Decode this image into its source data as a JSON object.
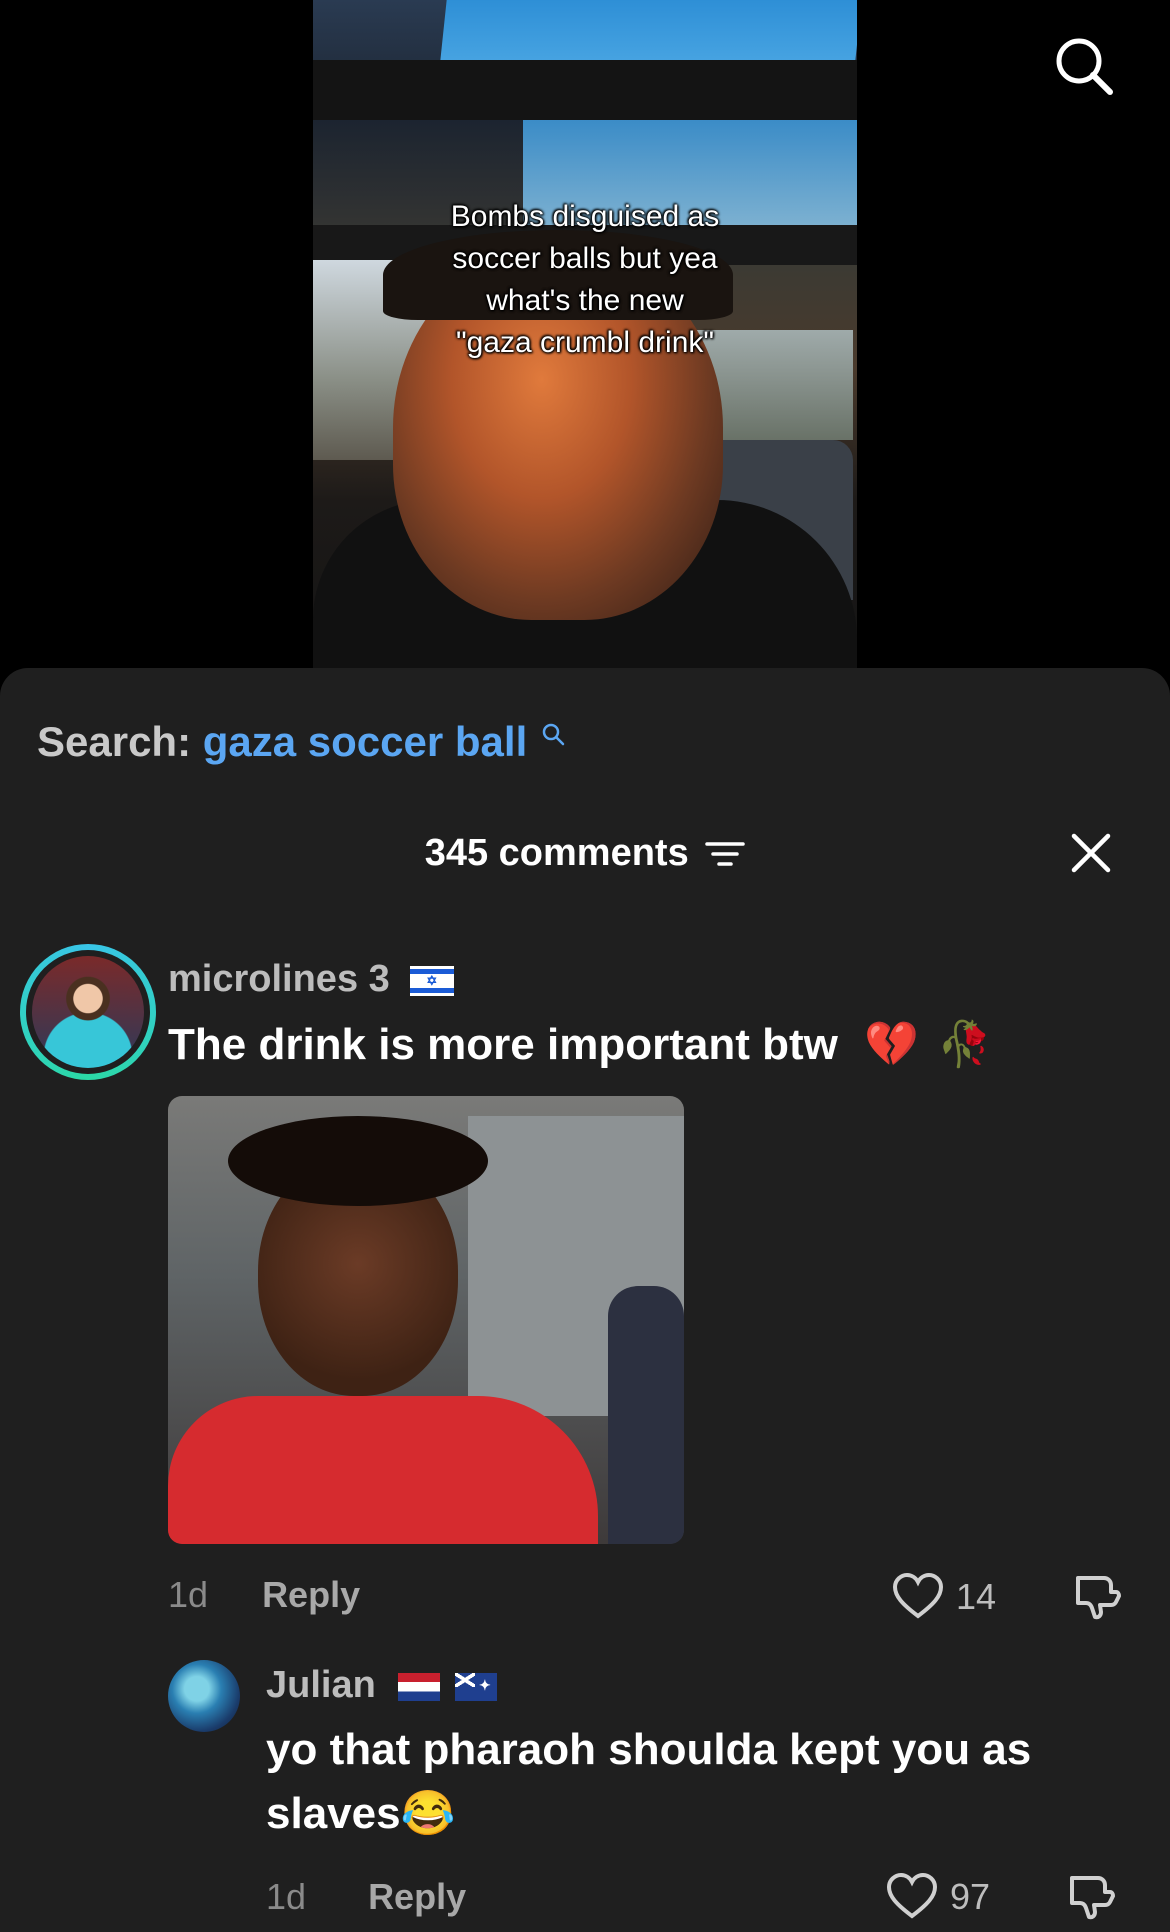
{
  "video": {
    "overlay_lines": [
      "Bombs disguised as",
      "soccer balls but yea",
      "what's the new",
      "\"gaza crumbl drink\""
    ]
  },
  "top_bar": {
    "search_icon": "search-icon"
  },
  "comments_sheet": {
    "search_label": "Search:",
    "search_term": "gaza soccer ball",
    "count_label": "345 comments",
    "filter_icon": "filter-icon",
    "close_icon": "close-icon"
  },
  "comments": [
    {
      "username": "microlines 3",
      "flags": [
        "🇮🇱"
      ],
      "text": "The drink is more important btw",
      "emojis": [
        "💔",
        "🥀"
      ],
      "has_gif": true,
      "age": "1d",
      "reply_label": "Reply",
      "likes": "14"
    },
    {
      "username": "Julian",
      "flags": [
        "🇳🇱",
        "🇦🇺"
      ],
      "text": "yo that pharaoh shoulda kept you as slaves",
      "emojis": [
        "😂"
      ],
      "age": "1d",
      "reply_label": "Reply",
      "likes": "97"
    }
  ],
  "colors": {
    "sheet_bg": "#1f1f1f",
    "link_blue": "#5ba6f2",
    "ring_teal": "#2bd9a5"
  }
}
